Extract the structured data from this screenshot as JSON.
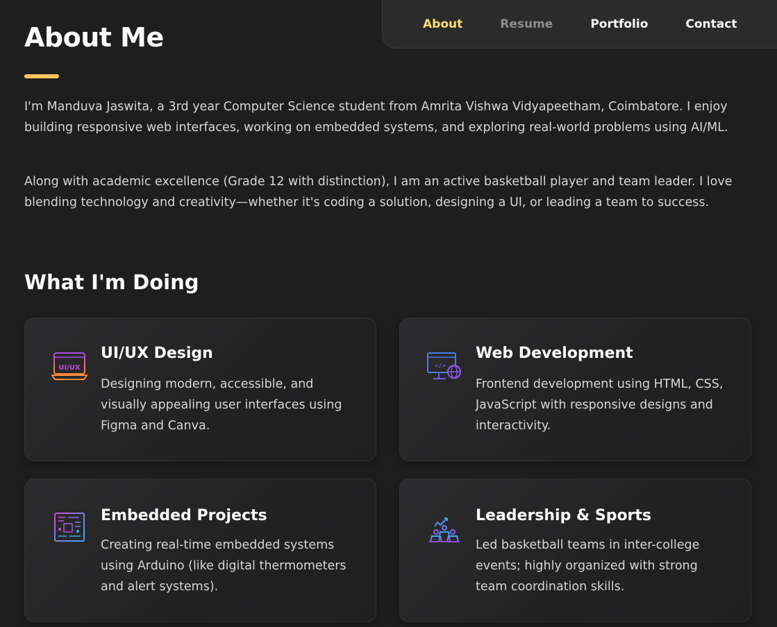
{
  "nav": {
    "items": [
      {
        "label": "About"
      },
      {
        "label": "Resume"
      },
      {
        "label": "Portfolio"
      },
      {
        "label": "Contact"
      }
    ]
  },
  "about": {
    "title": "About Me",
    "paragraphs": [
      "I'm Manduva Jaswita, a 3rd year Computer Science student from Amrita Vishwa Vidyapeetham, Coimbatore. I enjoy building responsive web interfaces, working on embedded systems, and exploring real-world problems using AI/ML.",
      "Along with academic excellence (Grade 12 with distinction), I am an active basketball player and team leader. I love blending technology and creativity—whether it's coding a solution, designing a UI, or leading a team to success."
    ]
  },
  "services": {
    "title": "What I'm Doing",
    "items": [
      {
        "icon": "ui-ux-icon",
        "title": "UI/UX Design",
        "text": "Designing modern, accessible, and visually appealing user interfaces using Figma and Canva.",
        "icon_text": "UI/UX"
      },
      {
        "icon": "web-development-icon",
        "title": "Web Development",
        "text": "Frontend development using HTML, CSS, JavaScript with responsive designs and interactivity."
      },
      {
        "icon": "circuit-board-icon",
        "title": "Embedded Projects",
        "text": "Creating real-time embedded systems using Arduino (like digital thermometers and alert systems)."
      },
      {
        "icon": "leadership-icon",
        "title": "Leadership & Sports",
        "text": "Led basketball teams in inter-college events; highly organized with strong team coordination skills."
      }
    ]
  },
  "colors": {
    "accent": "#ffdb70",
    "background": "#1e1e1f",
    "card": "#262627",
    "text": "#d6d6d6",
    "heading": "#fafafa"
  }
}
